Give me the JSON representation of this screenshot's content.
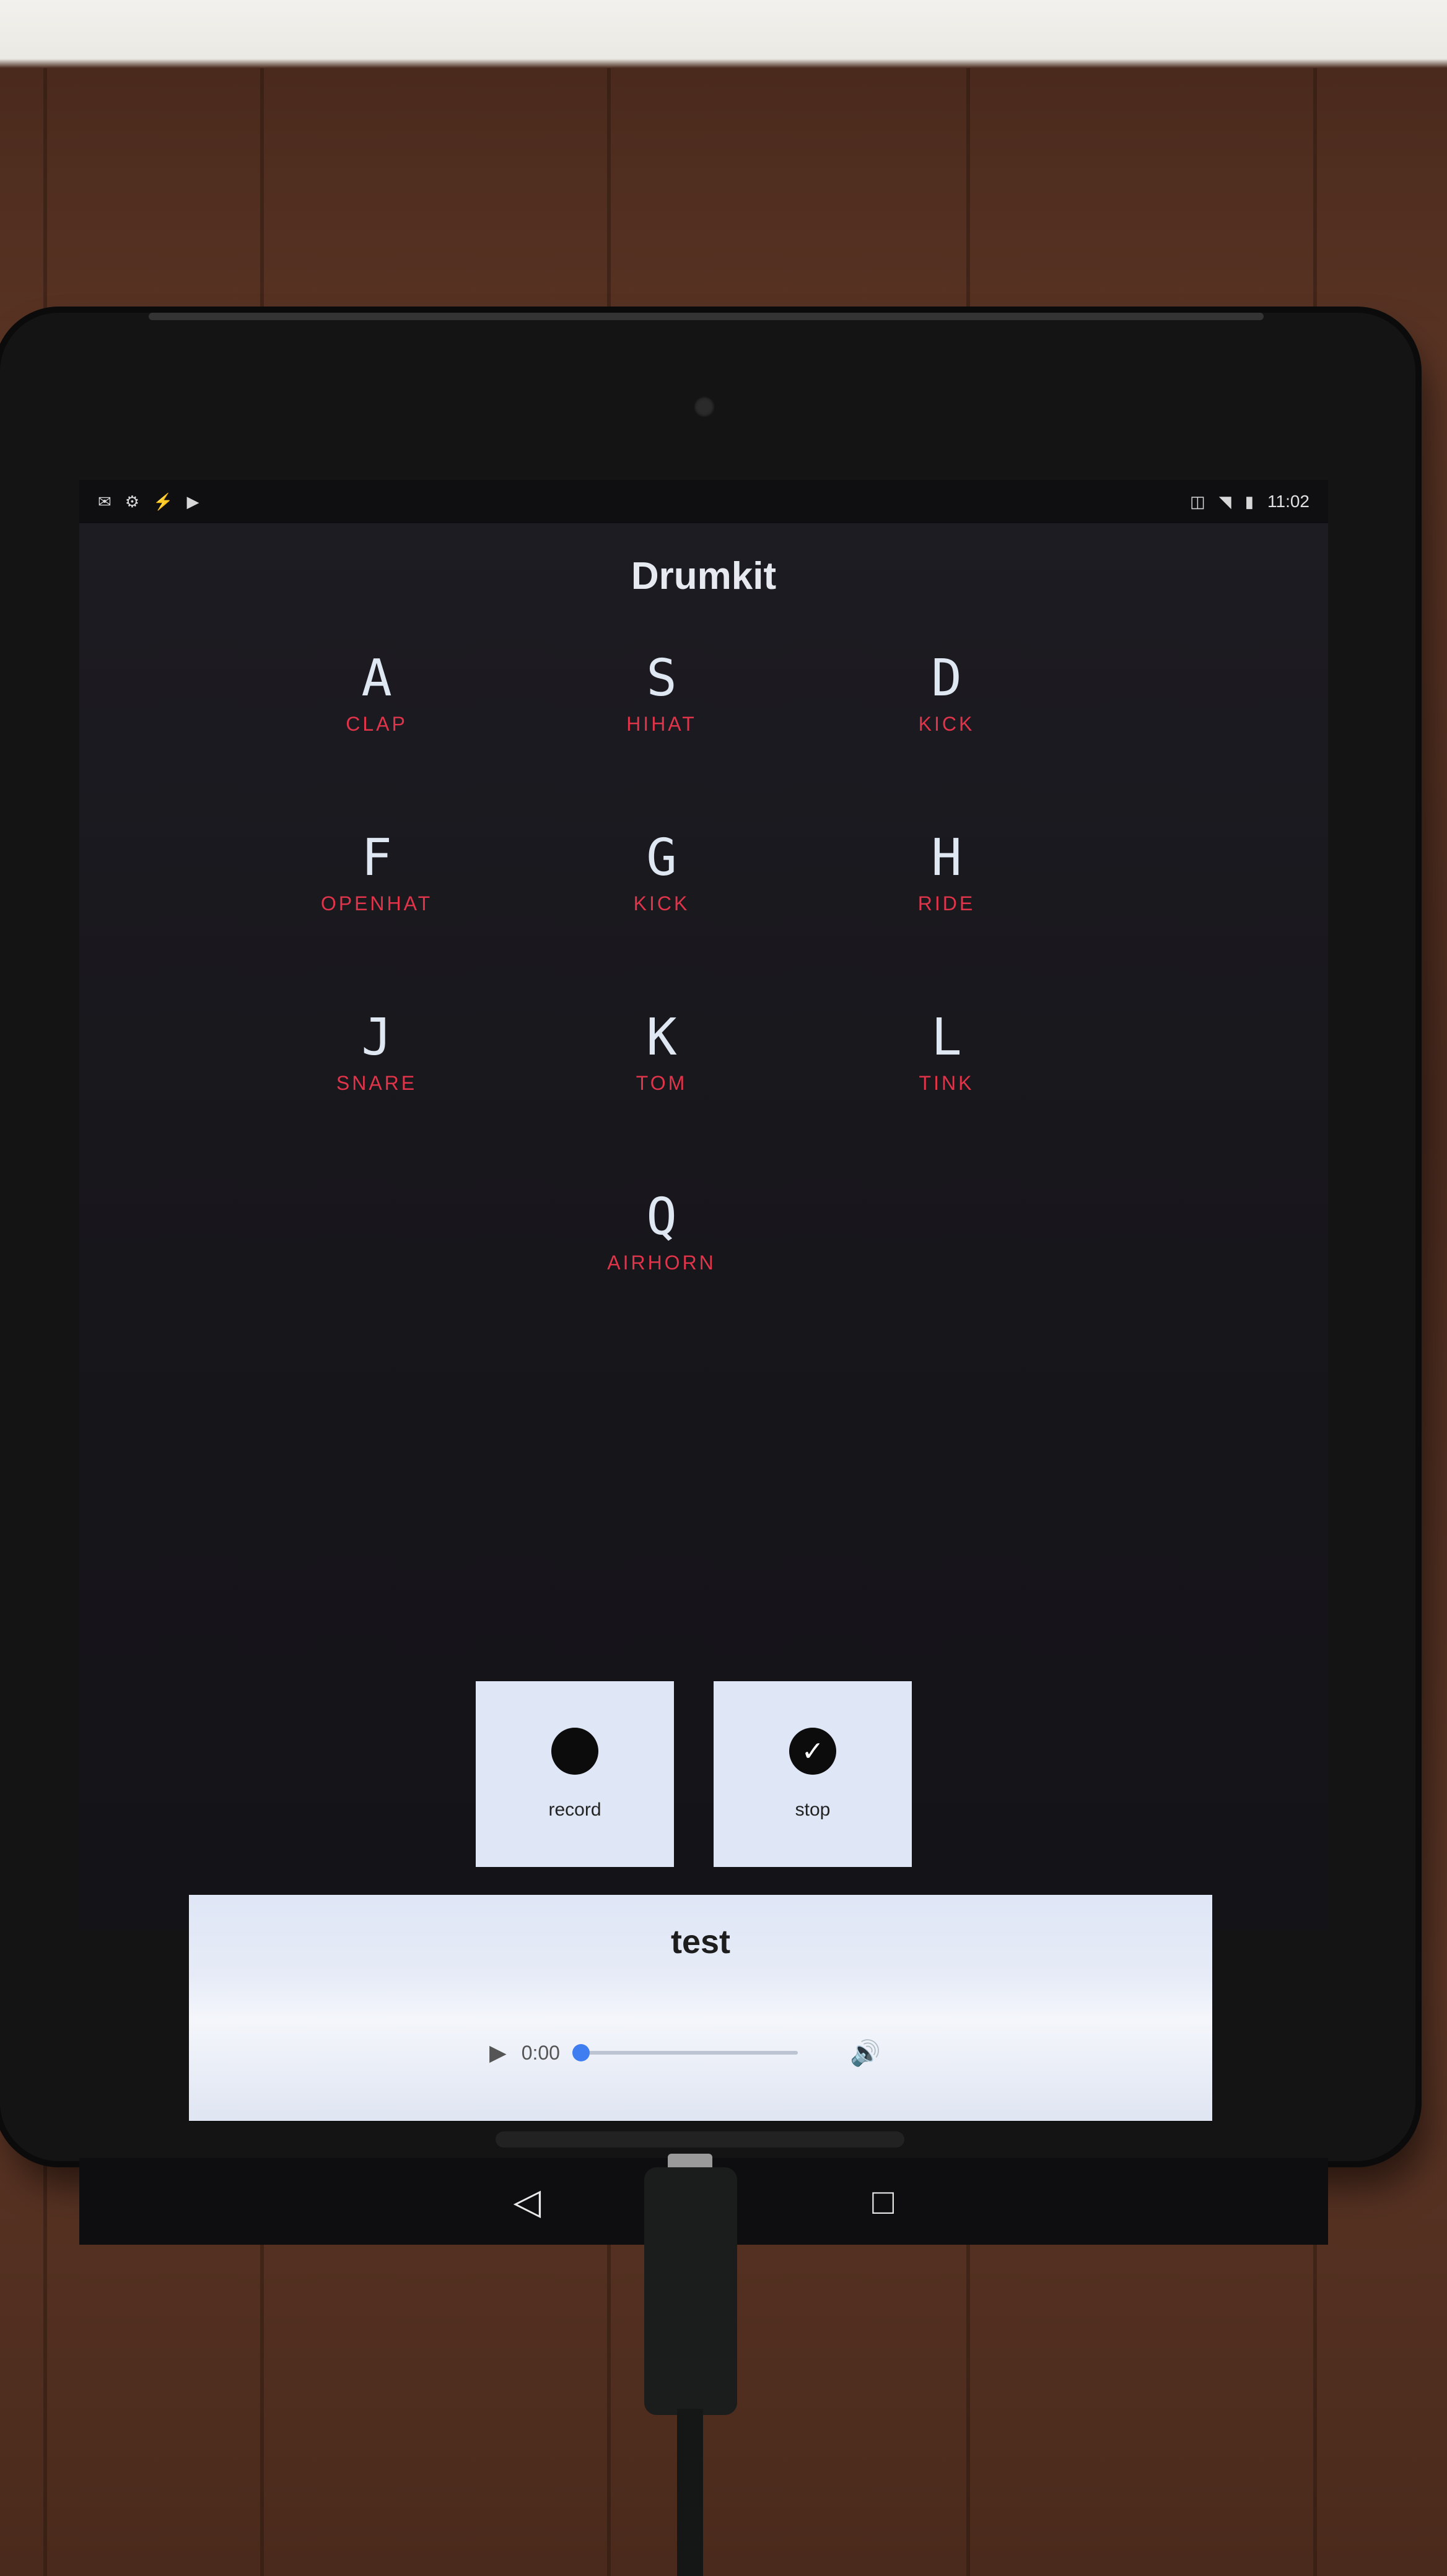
{
  "status_bar": {
    "left_icons": [
      "notification-icon",
      "notification-icon",
      "notification-icon",
      "play-store-icon"
    ],
    "right_icons": [
      "vibrate-icon",
      "wifi-icon",
      "battery-icon"
    ],
    "time": "11:02"
  },
  "app": {
    "title": "Drumkit"
  },
  "keys": [
    {
      "letter": "A",
      "sound": "CLAP"
    },
    {
      "letter": "S",
      "sound": "HIHAT"
    },
    {
      "letter": "D",
      "sound": "KICK"
    },
    {
      "letter": "F",
      "sound": "OPENHAT"
    },
    {
      "letter": "G",
      "sound": "KICK"
    },
    {
      "letter": "H",
      "sound": "RIDE"
    },
    {
      "letter": "J",
      "sound": "SNARE"
    },
    {
      "letter": "K",
      "sound": "TOM"
    },
    {
      "letter": "L",
      "sound": "TINK"
    },
    {
      "letter": "Q",
      "sound": "AIRHORN"
    }
  ],
  "controls": {
    "record_label": "record",
    "stop_label": "stop"
  },
  "recording": {
    "title": "test",
    "time": "0:00",
    "progress": 0
  },
  "nav": {
    "back": "◁",
    "home": "○",
    "recents": "□"
  },
  "colors": {
    "sound_label": "#e0344a",
    "key_letter": "#dfe7f2",
    "button_bg": "#dfe6f5",
    "seek_knob": "#3f7ef0"
  }
}
